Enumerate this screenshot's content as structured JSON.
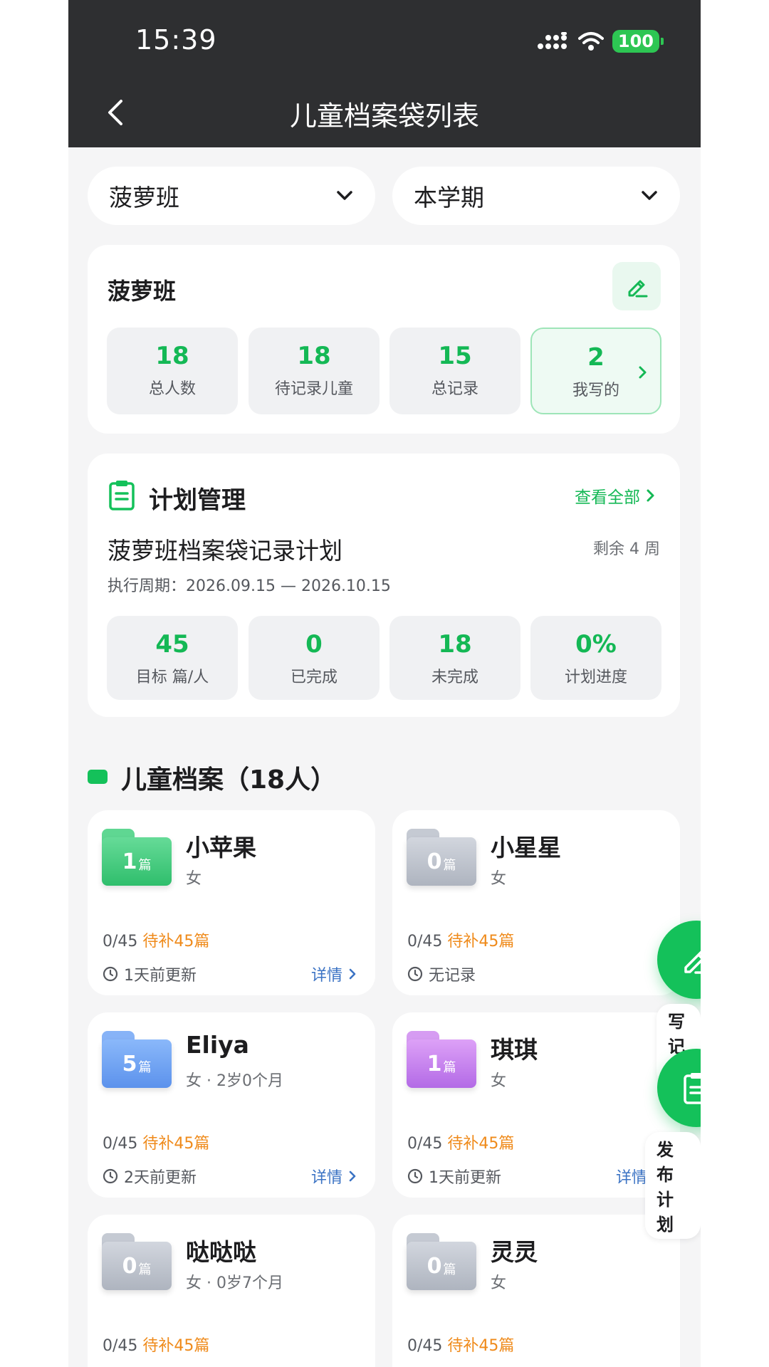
{
  "status_bar": {
    "time": "15:39",
    "battery": "100"
  },
  "header": {
    "title": "儿童档案袋列表"
  },
  "filters": {
    "class": "菠萝班",
    "term": "本学期"
  },
  "class_card": {
    "name": "菠萝班",
    "stats": [
      {
        "value": "18",
        "label": "总人数"
      },
      {
        "value": "18",
        "label": "待记录儿童"
      },
      {
        "value": "15",
        "label": "总记录"
      },
      {
        "value": "2",
        "label": "我写的"
      }
    ]
  },
  "plan": {
    "section_title": "计划管理",
    "view_all": "查看全部",
    "name": "菠萝班档案袋记录计划",
    "remaining": "剩余 4 周",
    "period": "执行周期：2026.09.15 — 2026.10.15",
    "stats": [
      {
        "value": "45",
        "label": "目标 篇/人"
      },
      {
        "value": "0",
        "label": "已完成"
      },
      {
        "value": "18",
        "label": "未完成"
      },
      {
        "value": "0%",
        "label": "计划进度"
      }
    ]
  },
  "children_section": {
    "title": "儿童档案（18人）"
  },
  "children": [
    {
      "name": "小苹果",
      "info": "女",
      "count": "1",
      "unit": "篇",
      "folder_color": "green",
      "progress": "0/45",
      "pending": "待补45篇",
      "updated": "1天前更新",
      "detail": "详情"
    },
    {
      "name": "小星星",
      "info": "女",
      "count": "0",
      "unit": "篇",
      "folder_color": "gray",
      "progress": "0/45",
      "pending": "待补45篇",
      "updated": "无记录",
      "detail": ""
    },
    {
      "name": "Eliya",
      "info": "女 · 2岁0个月",
      "count": "5",
      "unit": "篇",
      "folder_color": "blue",
      "progress": "0/45",
      "pending": "待补45篇",
      "updated": "2天前更新",
      "detail": "详情"
    },
    {
      "name": "琪琪",
      "info": "女",
      "count": "1",
      "unit": "篇",
      "folder_color": "purple",
      "progress": "0/45",
      "pending": "待补45篇",
      "updated": "1天前更新",
      "detail": "详情"
    },
    {
      "name": "哒哒哒",
      "info": "女 · 0岁7个月",
      "count": "0",
      "unit": "篇",
      "folder_color": "gray",
      "progress": "0/45",
      "pending": "待补45篇",
      "updated": "",
      "detail": ""
    },
    {
      "name": "灵灵",
      "info": "女",
      "count": "0",
      "unit": "篇",
      "folder_color": "gray",
      "progress": "0/45",
      "pending": "待补45篇",
      "updated": "",
      "detail": ""
    }
  ],
  "fabs": {
    "write": "写记录",
    "publish": "发布计划"
  },
  "colors": {
    "accent": "#14c15a",
    "pending": "#ef8a1a",
    "link": "#3b73c4",
    "header_bg": "#2e2f31"
  }
}
